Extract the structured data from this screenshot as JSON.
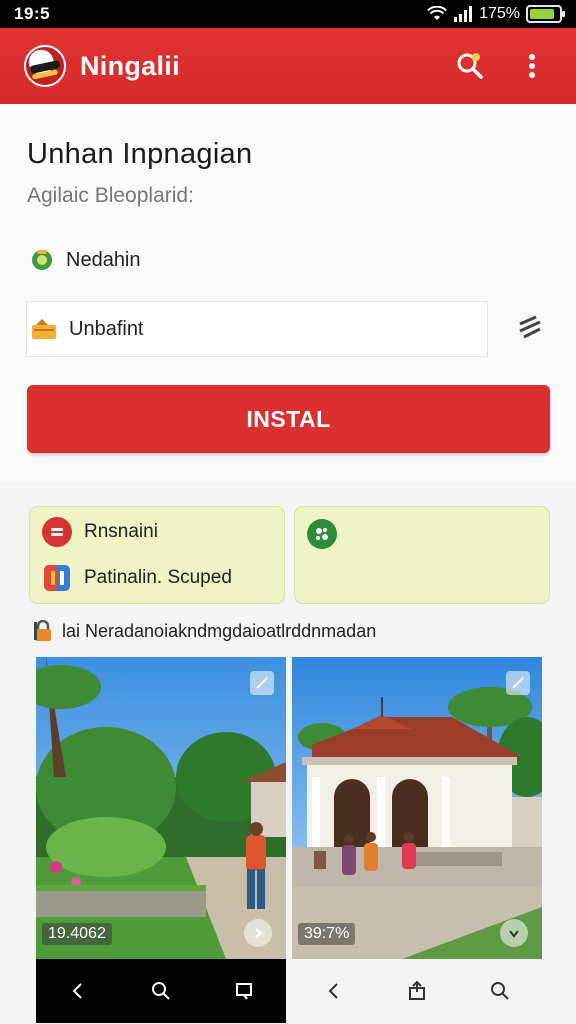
{
  "status_bar": {
    "time": "19:5",
    "battery_text": "175%",
    "battery_level": 0.85,
    "battery_color": "#9bd13b"
  },
  "app_bar": {
    "title": "Ningalii",
    "search_icon": "search-icon",
    "menu_icon": "more-vert-icon",
    "color": "#dc2f2f"
  },
  "header": {
    "title": "Unhan Inpnagian",
    "subtitle": "Agilaic Bleoplarid:",
    "developer_label": "Nedahin",
    "field_label": "Unbafint",
    "install_label": "INSTAL"
  },
  "info_cards": {
    "left": {
      "item1": "Rnsnaini",
      "item2": "Patinalin. Scuped"
    },
    "right": {
      "item1": ""
    }
  },
  "note": "lai Neradanoiakndmgdaioatlrddnmadan",
  "screenshots": [
    {
      "badge": "19.4062",
      "nav": [
        "back-icon",
        "search-icon",
        "square-icon"
      ]
    },
    {
      "badge": "39:7%",
      "nav": [
        "back-icon",
        "share-icon",
        "search-icon"
      ]
    }
  ]
}
